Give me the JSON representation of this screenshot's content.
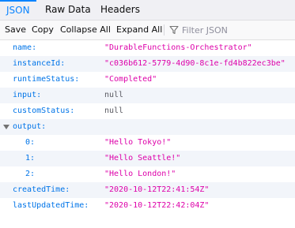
{
  "tabs": {
    "json": "JSON",
    "raw": "Raw Data",
    "headers": "Headers"
  },
  "toolbar": {
    "save": "Save",
    "copy": "Copy",
    "collapse_all": "Collapse All",
    "expand_all": "Expand All",
    "filter_placeholder": "Filter JSON",
    "filter_icon": "filter-icon"
  },
  "tree": {
    "name": {
      "key": "name:",
      "value": "\"DurableFunctions-Orchestrator\""
    },
    "instanceId": {
      "key": "instanceId:",
      "value": "\"c036b612-5779-4d90-8c1e-fd4b822ec3be\""
    },
    "runtimeStatus": {
      "key": "runtimeStatus:",
      "value": "\"Completed\""
    },
    "input": {
      "key": "input:",
      "value": "null"
    },
    "customStatus": {
      "key": "customStatus:",
      "value": "null"
    },
    "output": {
      "key": "output:",
      "expanded": true,
      "items": [
        {
          "key": "0:",
          "value": "\"Hello Tokyo!\""
        },
        {
          "key": "1:",
          "value": "\"Hello Seattle!\""
        },
        {
          "key": "2:",
          "value": "\"Hello London!\""
        }
      ]
    },
    "createdTime": {
      "key": "createdTime:",
      "value": "\"2020-10-12T22:41:54Z\""
    },
    "lastUpdatedTime": {
      "key": "lastUpdatedTime:",
      "value": "\"2020-10-12T22:42:04Z\""
    }
  },
  "colors": {
    "accent": "#0a84ff",
    "key": "#0074e8",
    "string": "#dd00a9",
    "null": "#5a5a62",
    "alt_row": "#f2f5fa"
  }
}
